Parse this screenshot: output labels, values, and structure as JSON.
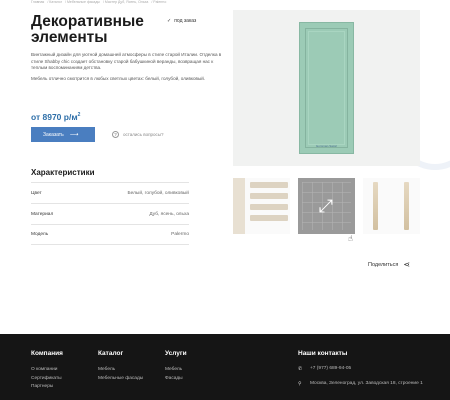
{
  "breadcrumb": [
    "Главная",
    "Каталог",
    "Мебельные фасады",
    "Мастер Дуб, Ясень, Ольха",
    "Palermo"
  ],
  "product": {
    "title": "Декоративные элементы",
    "badge": "под заказ",
    "description": [
      "Винтажный дизайн для уютной домашней атмосферы в стиле старой Италии. Отделка в стиле Shabby chic создает обстановку старой бабушкиной веранды, возвращая нас к теплым воспоминаниям детства.",
      "Мебель отлично смотрится в любых светлых цветах: белый, голубой, оливковый."
    ],
    "price": "от 8970 р/м",
    "price_sup": "2",
    "order_label": "Заказать",
    "question_label": "остались вопросы?",
    "image_caption": "Gomman-Satori"
  },
  "characteristics": {
    "title": "Характеристики",
    "rows": [
      {
        "key": "Цвет",
        "value": "Белый, голубой, оливковый"
      },
      {
        "key": "Материал",
        "value": "Дуб, ясень, ольха"
      },
      {
        "key": "Модель",
        "value": "Palermo"
      }
    ]
  },
  "share_label": "Поделиться",
  "footer": {
    "company": {
      "title": "Компания",
      "links": [
        "О компании",
        "Сертификаты",
        "Партнеры"
      ]
    },
    "catalog": {
      "title": "Каталог",
      "links": [
        "Мебель",
        "Мебельные фасады"
      ]
    },
    "services": {
      "title": "Услуги",
      "links": [
        "Мебель",
        "Фасады"
      ]
    },
    "contacts": {
      "title": "Наши контакты",
      "phone": "+7 (977) 689-94-05",
      "address": "Москва, Зеленоград, ул. Заводская 18, строение 1"
    }
  },
  "colors": {
    "accent": "#4a7ec0",
    "price": "#2d6ea8",
    "footer_bg": "#151515",
    "panel": "#9ccbb6"
  }
}
